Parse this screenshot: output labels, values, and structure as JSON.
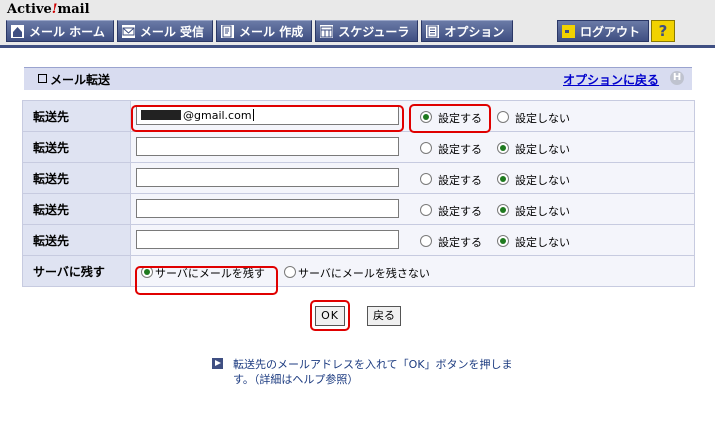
{
  "app": {
    "logo_text": "Active",
    "logo_bang": "!",
    "logo_suffix": "mail"
  },
  "nav": [
    {
      "label": "メール ホーム",
      "icon": "home-icon"
    },
    {
      "label": "メール 受信",
      "icon": "envelope-icon"
    },
    {
      "label": "メール 作成",
      "icon": "compose-icon"
    },
    {
      "label": "スケジューラ",
      "icon": "calendar-icon"
    },
    {
      "label": "オプション",
      "icon": "options-icon"
    }
  ],
  "logout_label": "ログアウト",
  "help_label": "?",
  "section": {
    "title": "メール転送",
    "back_link": "オプションに戻る",
    "help_icon_label": "H"
  },
  "rows": [
    {
      "label": "転送先",
      "value": "@gmail.com",
      "opt_on": "設定する",
      "opt_off": "設定しない",
      "selected": "on"
    },
    {
      "label": "転送先",
      "value": "",
      "opt_on": "設定する",
      "opt_off": "設定しない",
      "selected": "off"
    },
    {
      "label": "転送先",
      "value": "",
      "opt_on": "設定する",
      "opt_off": "設定しない",
      "selected": "off"
    },
    {
      "label": "転送先",
      "value": "",
      "opt_on": "設定する",
      "opt_off": "設定しない",
      "selected": "off"
    },
    {
      "label": "転送先",
      "value": "",
      "opt_on": "設定する",
      "opt_off": "設定しない",
      "selected": "off"
    }
  ],
  "server_row": {
    "label": "サーバに残す",
    "opt_keep": "サーバにメールを残す",
    "opt_nokeep": "サーバにメールを残さない",
    "selected": "keep"
  },
  "buttons": {
    "ok": "OK",
    "back": "戻る"
  },
  "note": "転送先のメールアドレスを入れて「OK」ボタンを押します。（詳細はヘルプ参照）",
  "colors": {
    "nav": "#3f4f82",
    "highlight": "#e00000",
    "link": "#0000cc"
  }
}
